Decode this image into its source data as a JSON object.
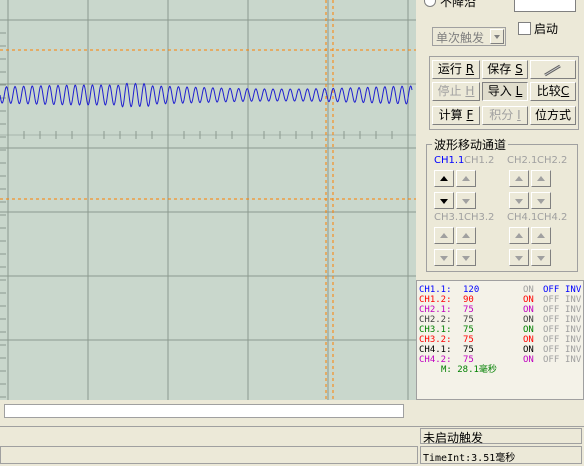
{
  "top_panel": {
    "radio_label": "不降沿",
    "start_checkbox_label": "启动",
    "trigger_mode_select": "单次触发"
  },
  "buttons": {
    "run": "运行",
    "run_key": "R",
    "save": "保存",
    "save_key": "S",
    "stop": "停止",
    "stop_key": "H",
    "import": "导入",
    "import_key": "L",
    "compare": "比较",
    "compare_key": "C",
    "compute": "计算",
    "compute_key": "F",
    "integrate": "积分",
    "integrate_key": "I",
    "position_mode": "位方式"
  },
  "move_channel": {
    "title": "波形移动通道",
    "ch11": "CH1.1",
    "ch12": "CH1.2",
    "ch21": "CH2.1",
    "ch22": "CH2.2",
    "ch31": "CH3.1",
    "ch32": "CH3.2",
    "ch41": "CH4.1",
    "ch42": "CH4.2"
  },
  "channel_status": [
    {
      "name": "CH1.1:",
      "value": "120",
      "on": "ON",
      "off": "OFF",
      "inv": "INV",
      "color": "#0000FF"
    },
    {
      "name": "CH1.2:",
      "value": "90",
      "on": "ON",
      "off": "OFF",
      "inv": "INV",
      "color": "#FF0000"
    },
    {
      "name": "CH2.1:",
      "value": "75",
      "on": "ON",
      "off": "OFF",
      "inv": "INV",
      "color": "#C000C0"
    },
    {
      "name": "CH2.2:",
      "value": "75",
      "on": "ON",
      "off": "OFF",
      "inv": "INV",
      "color": "#404040"
    },
    {
      "name": "CH3.1:",
      "value": "75",
      "on": "ON",
      "off": "OFF",
      "inv": "INV",
      "color": "#008000"
    },
    {
      "name": "CH3.2:",
      "value": "75",
      "on": "ON",
      "off": "OFF",
      "inv": "INV",
      "color": "#FF0000"
    },
    {
      "name": "CH4.1:",
      "value": "75",
      "on": "ON",
      "off": "OFF",
      "inv": "INV",
      "color": "#000000"
    },
    {
      "name": "CH4.2:",
      "value": "75",
      "on": "ON",
      "off": "OFF",
      "inv": "INV",
      "color": "#C000C0"
    }
  ],
  "measure": "M: 28.1毫秒",
  "status_bar": {
    "trigger_status": "未启动触发",
    "time_interval": "TimeInt:3.51毫秒"
  },
  "colors": {
    "scope_bg": "#C9D7CC",
    "grid": "#8C9A8F",
    "cursor": "#FF8000",
    "wave": "#2020D0"
  }
}
